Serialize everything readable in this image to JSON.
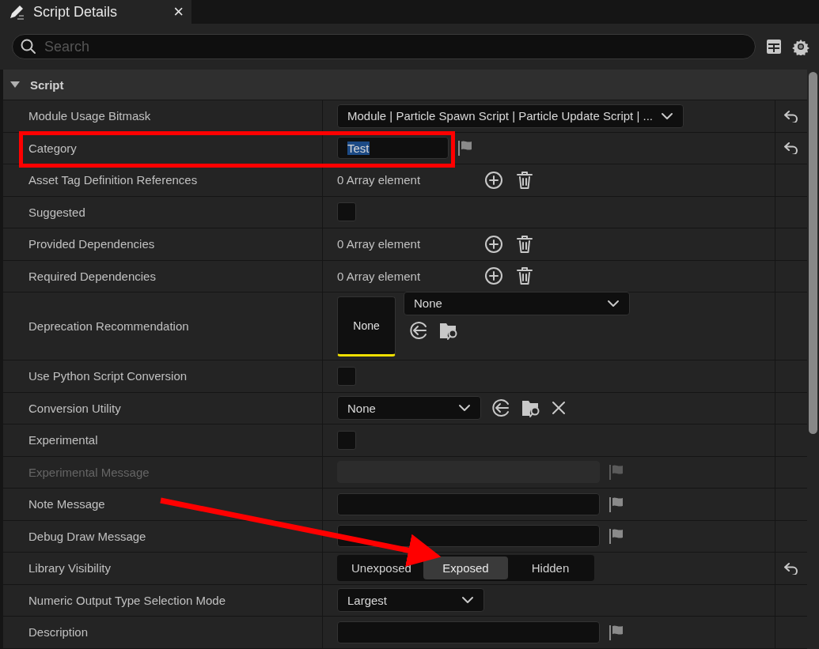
{
  "tab": {
    "title": "Script Details",
    "close": "×"
  },
  "search": {
    "placeholder": "Search"
  },
  "section": {
    "title": "Script",
    "expanded": true
  },
  "rows": [
    {
      "label": "Module Usage Bitmask",
      "kind": "dropdown",
      "value": "Module | Particle Spawn Script | Particle Update Script | ...",
      "reset": true
    },
    {
      "label": "Category",
      "kind": "short-text",
      "value": "Test",
      "text_selected": true,
      "reset": true
    },
    {
      "label": "Asset Tag Definition References",
      "kind": "array",
      "value": "0 Array element"
    },
    {
      "label": "Suggested",
      "kind": "checkbox",
      "checked": false
    },
    {
      "label": "Provided Dependencies",
      "kind": "array",
      "value": "0 Array element"
    },
    {
      "label": "Required Dependencies",
      "kind": "array",
      "value": "0 Array element"
    },
    {
      "label": "Deprecation Recommendation",
      "kind": "asset",
      "thumb": "None",
      "value": "None"
    },
    {
      "label": "Use Python Script Conversion",
      "kind": "checkbox",
      "checked": false
    },
    {
      "label": "Conversion Utility",
      "kind": "class",
      "value": "None"
    },
    {
      "label": "Experimental",
      "kind": "checkbox",
      "checked": false
    },
    {
      "label": "Experimental Message",
      "kind": "text",
      "disabled": true
    },
    {
      "label": "Note Message",
      "kind": "text",
      "disabled": false
    },
    {
      "label": "Debug Draw Message",
      "kind": "text",
      "disabled": false
    },
    {
      "label": "Library Visibility",
      "kind": "segmented",
      "options": [
        {
          "label": "Unexposed",
          "selected": false
        },
        {
          "label": "Exposed",
          "selected": true
        },
        {
          "label": "Hidden",
          "selected": false
        }
      ],
      "reset": true
    },
    {
      "label": "Numeric Output Type Selection Mode",
      "kind": "small-dropdown",
      "value": "Largest"
    },
    {
      "label": "Description",
      "kind": "text",
      "disabled": false
    }
  ],
  "annotations": [
    {
      "kind": "highlight-box"
    },
    {
      "kind": "arrow"
    }
  ]
}
